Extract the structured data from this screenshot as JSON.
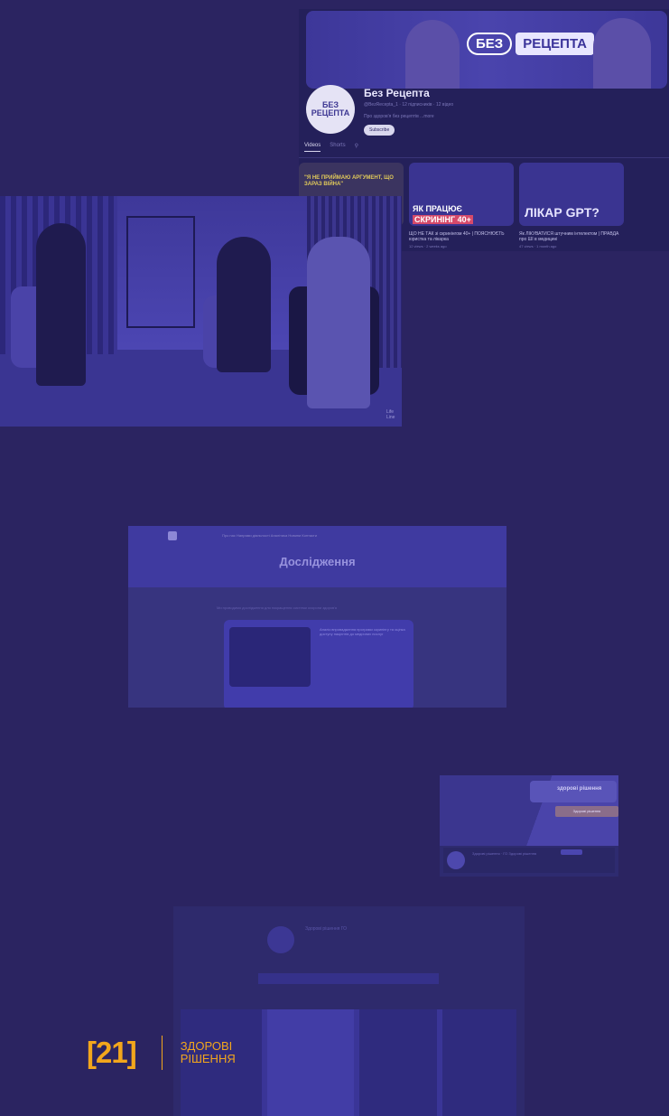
{
  "youtube": {
    "banner_left": "БЕЗ",
    "banner_right": "РЕЦЕПТА",
    "avatar_text": "БЕЗ РЕЦЕПТА",
    "channel_name": "Без Рецепта",
    "handle": "@BezRecepta_1 · 12 підписників · 12 відео",
    "description": "Про здоров'я без рецептів ...more",
    "subscribe": "Subscribe",
    "tabs": [
      "Videos",
      "Shorts"
    ],
    "videos": [
      {
        "title": "\"Я НЕ ПРИЙМАЮ АРГУМЕНТ, ЩО ЗАРАЗ ВІЙНА\"",
        "caption": "",
        "meta": ""
      },
      {
        "title": "ЯК ПРАЦЮЄ",
        "title2": "СКРИНІНГ 40+",
        "caption": "ЩО НЕ ТАК зі скринінгом 40+ | ПОЯСНЮЄТЬ юристка та лікарка",
        "meta": "12 views · 2 weeks ago"
      },
      {
        "title": "ЛІКАР GPT?",
        "caption": "Як ЛІКУВАТИСЯ штучним інтелектом | ПРАВДА про ШІ в медицині",
        "meta": "47 views · 1 month ago"
      }
    ]
  },
  "photo": {
    "watermark": "Life Line"
  },
  "website": {
    "title": "Дослідження",
    "nav": "Про нас   Напрями діяльності   Аналітика   Новини   Контакти",
    "intro": "Ми проводимо дослідження для покращення системи охорони здоров'я",
    "card_text": "Аналіз впровадження програми скринінгу та оцінка доступу пацієнтів до медичних послуг"
  },
  "facebook": {
    "brand": "здорові рішення",
    "promo": "Здорові рішення",
    "page_name": "Здорові рішення · ГО Здорові рішення"
  },
  "bottom": {
    "title": "Здорові рішення ГО"
  },
  "logo": {
    "number": "[21]",
    "line1": "ЗДОРОВІ",
    "line2": "РІШЕННЯ"
  }
}
